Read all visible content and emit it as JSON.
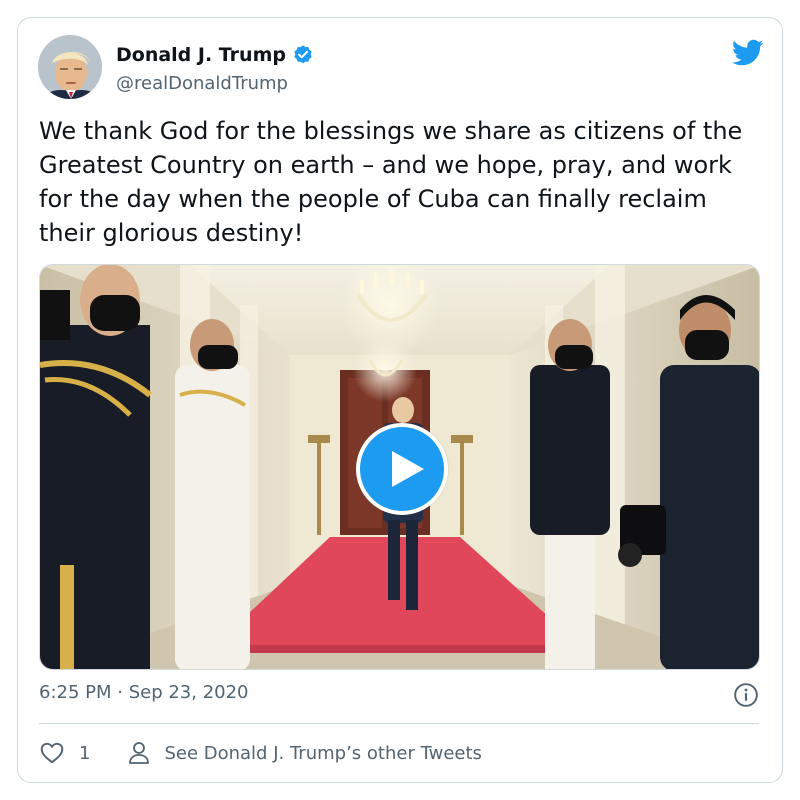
{
  "author": {
    "name": "Donald J. Trump",
    "handle": "@realDonaldTrump"
  },
  "icons": {
    "avatar": "avatar-photo",
    "verified": "verified-badge-icon",
    "brand": "twitter-bird-icon",
    "play": "play-icon",
    "info": "info-icon",
    "like": "heart-icon",
    "profile": "person-icon"
  },
  "tweet": {
    "text": "We thank God for the blessings we share as citizens of the Greatest Country on earth – and we hope, pray, and work for the day when the people of Cuba can finally reclaim their glorious destiny!",
    "timestamp": "6:25 PM · Sep 23, 2020",
    "like_count": "1",
    "other_tweets_label": "See Donald J. Trump’s other Tweets"
  },
  "colors": {
    "accent": "#1d9bf0",
    "text": "#0f1419",
    "secondary": "#536471",
    "border": "#cfd9de",
    "carpet": "#e0475a"
  }
}
